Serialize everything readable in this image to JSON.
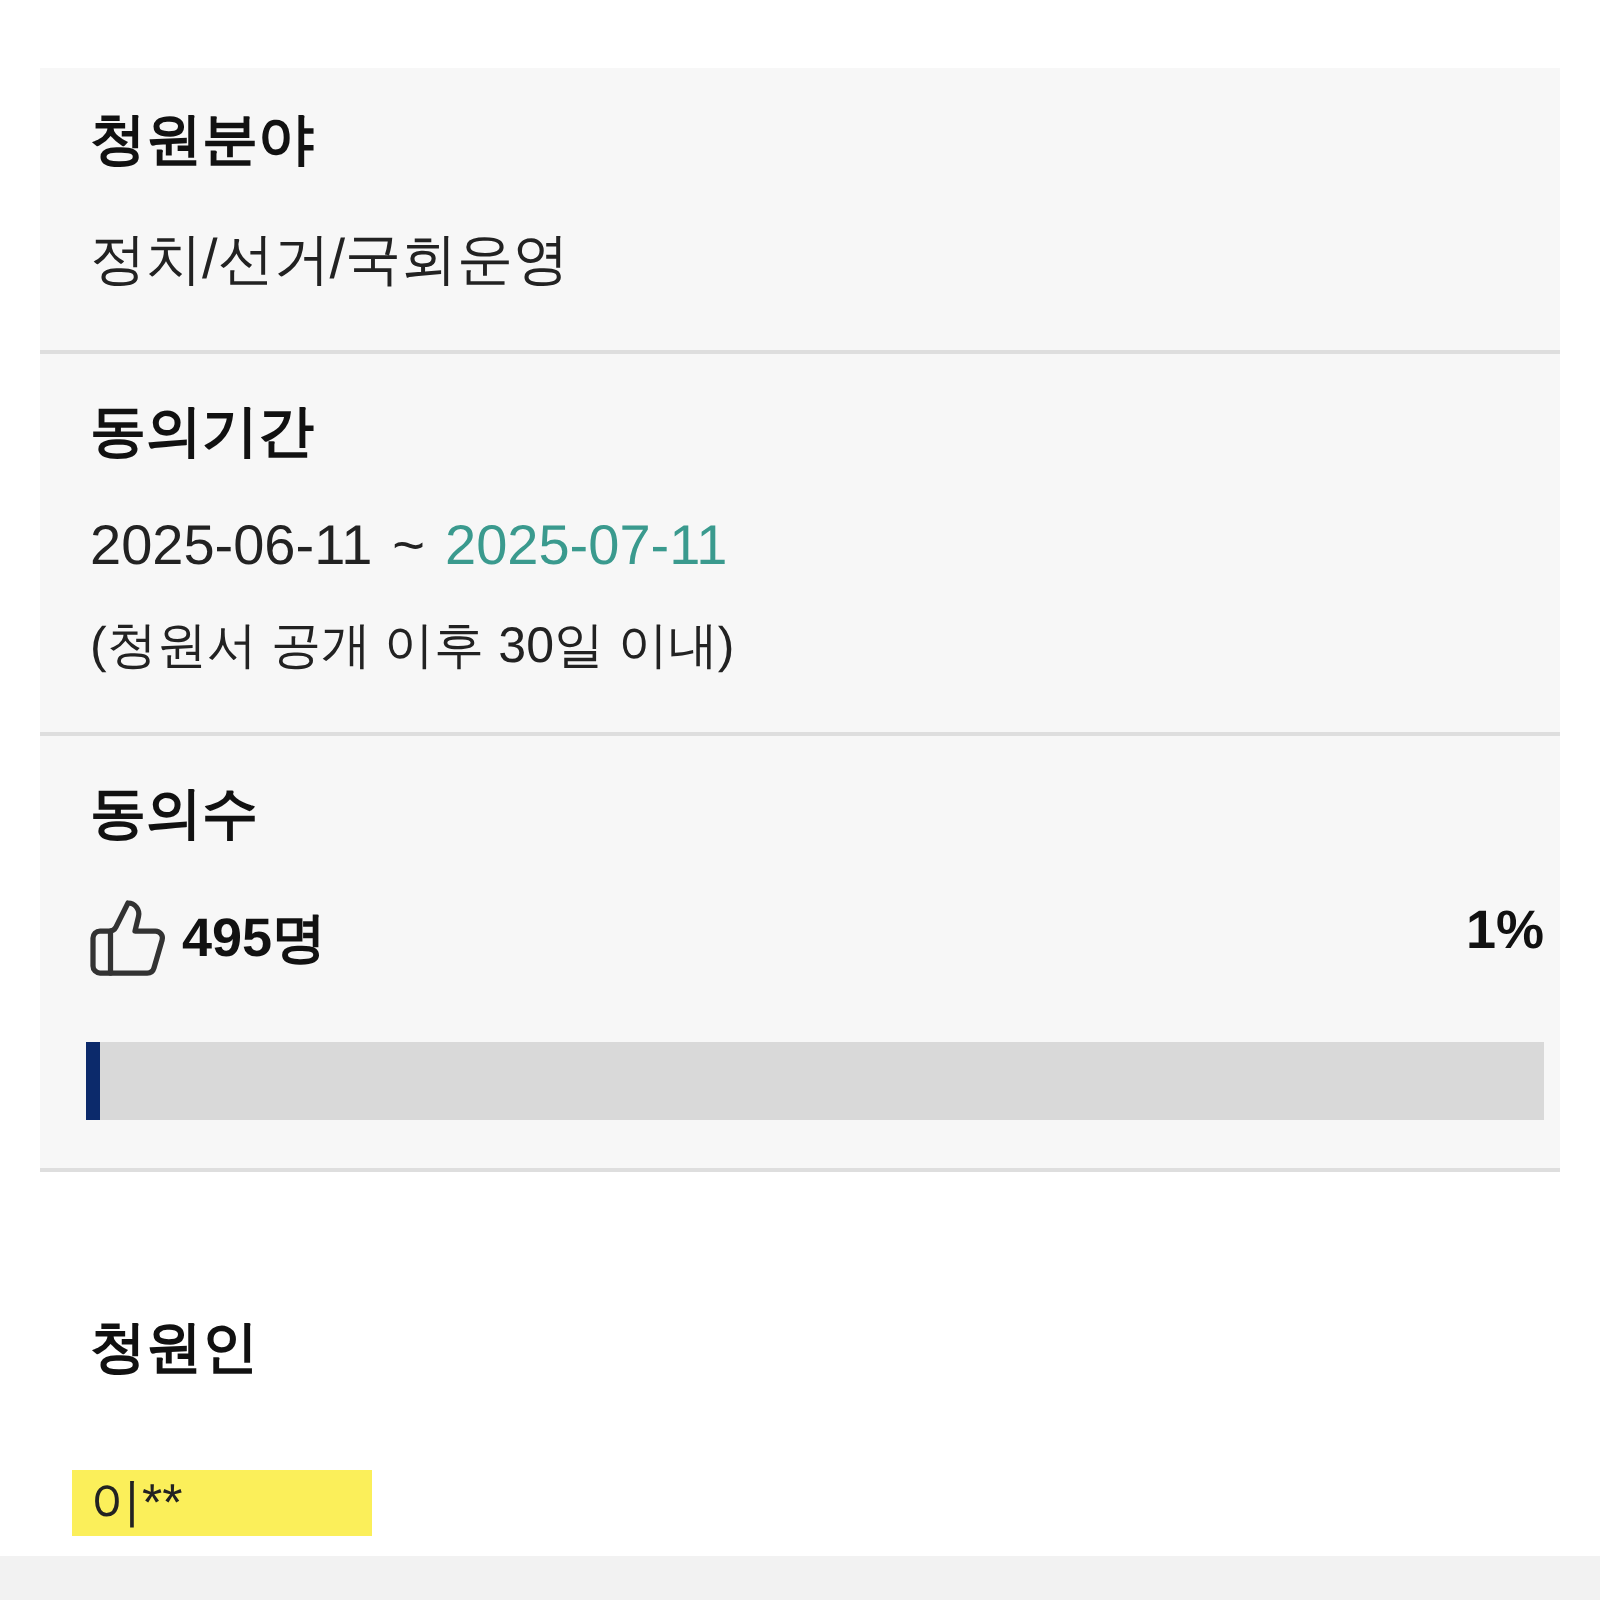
{
  "fields": [
    {
      "kind": "text",
      "title": "청원분야",
      "value": "정치/선거/국회운영"
    },
    {
      "kind": "period",
      "title": "동의기간",
      "start": "2025-06-11",
      "separator": "~",
      "end": "2025-07-11",
      "note": "(청원서 공개 이후 30일 이내)"
    },
    {
      "kind": "progress",
      "title": "동의수",
      "count": "495명",
      "percent": "1%",
      "level": 0.01
    }
  ],
  "petitioner": {
    "title": "청원인",
    "name": "이**",
    "highlighted": true
  }
}
